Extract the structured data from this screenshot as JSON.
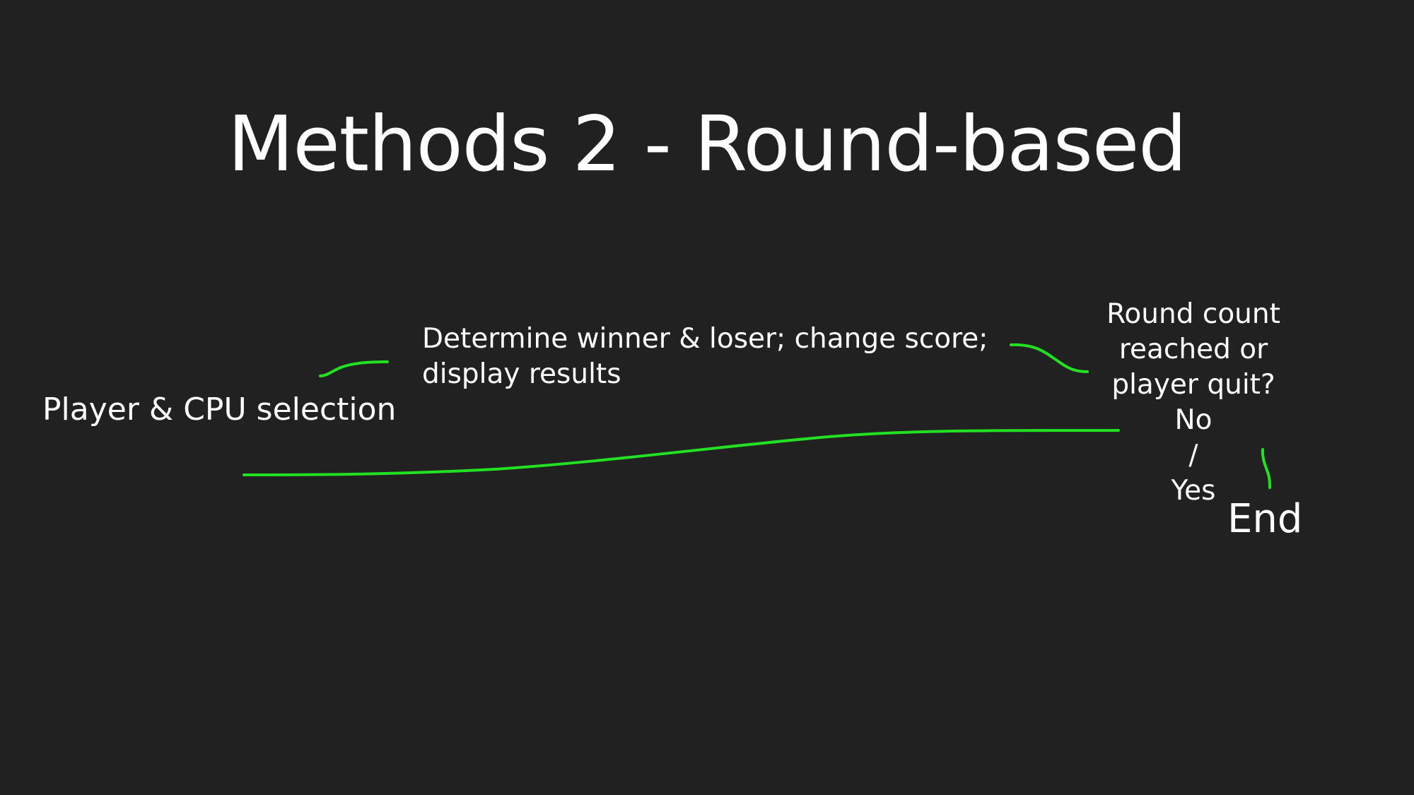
{
  "slide": {
    "title": "Methods 2 - Round-based"
  },
  "nodes": {
    "selection": "Player & CPU selection",
    "determine_line1": "Determine winner & loser; change score;",
    "determine_line2": "display results",
    "decision_line1": "Round count",
    "decision_line2": "reached or",
    "decision_line3": "player quit?",
    "decision_no": "No",
    "decision_separator": "/",
    "decision_yes": "Yes",
    "end": "End"
  },
  "colors": {
    "background": "#212121",
    "text": "#ffffff",
    "connector": "#22e022"
  }
}
